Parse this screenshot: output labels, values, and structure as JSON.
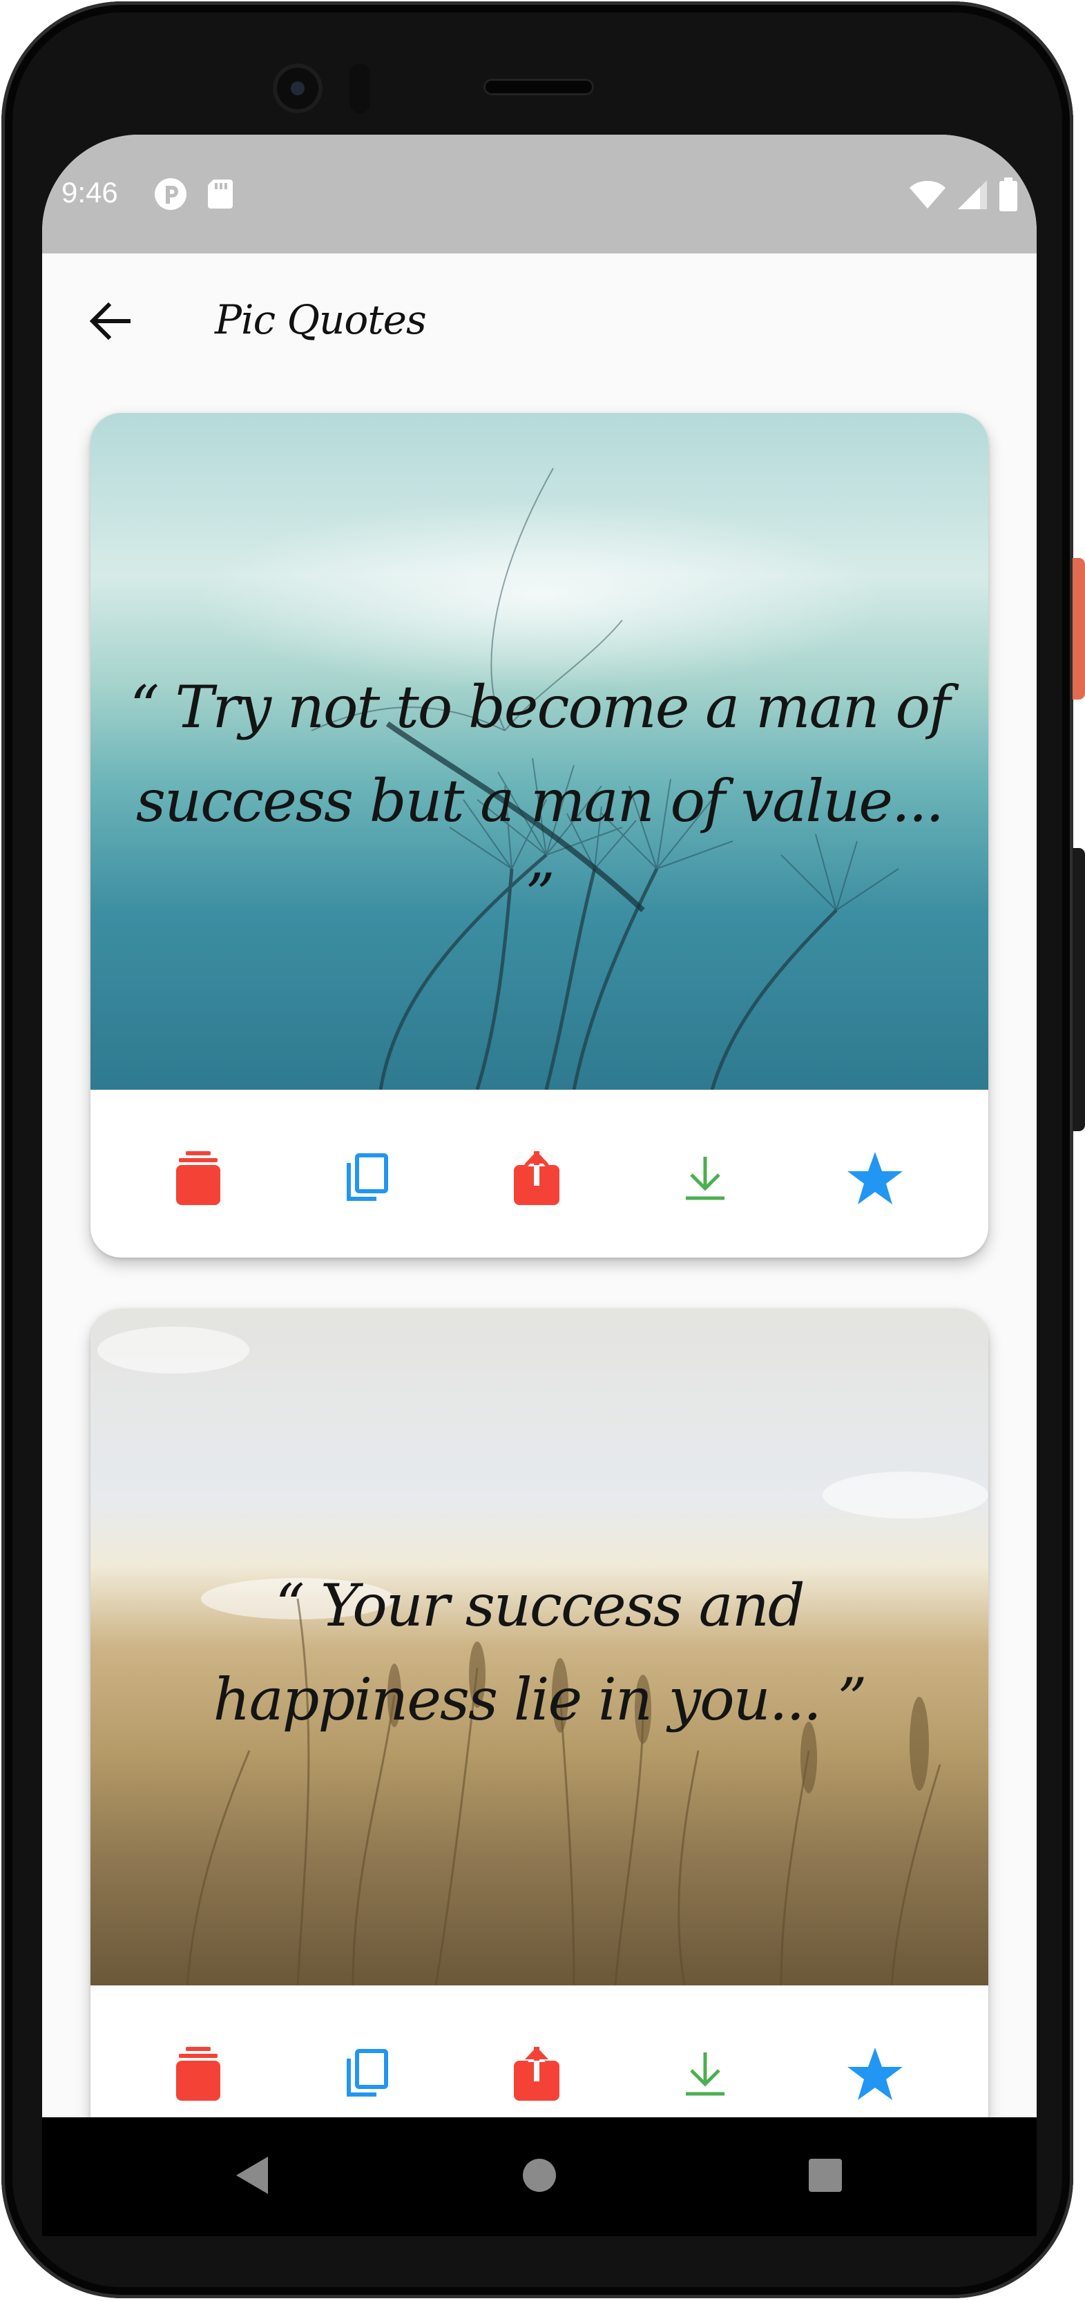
{
  "status_bar": {
    "time": "9:46",
    "left_icons": [
      "app-notification-icon",
      "sd-card-icon"
    ],
    "right_icons": [
      "wifi-icon",
      "cell-signal-icon",
      "battery-icon"
    ]
  },
  "app_bar": {
    "title": "Pic Quotes",
    "back_icon": "arrow-back-icon"
  },
  "quotes": [
    {
      "text": "“ Try not to become a man of success but a man of value... ”",
      "background": "dandelion"
    },
    {
      "text": "“ Your success and happiness lie in you... ”",
      "background": "wheat-field"
    }
  ],
  "actions": [
    {
      "icon": "delete-icon",
      "color": "#F44336"
    },
    {
      "icon": "copy-icon",
      "color": "#2196F3"
    },
    {
      "icon": "share-icon",
      "color": "#F44336"
    },
    {
      "icon": "download-icon",
      "color": "#4CAF50"
    },
    {
      "icon": "favorite-star-icon",
      "color": "#2196F3"
    }
  ],
  "nav_bar": {
    "buttons": [
      "nav-back-icon",
      "nav-home-icon",
      "nav-recents-icon"
    ]
  }
}
